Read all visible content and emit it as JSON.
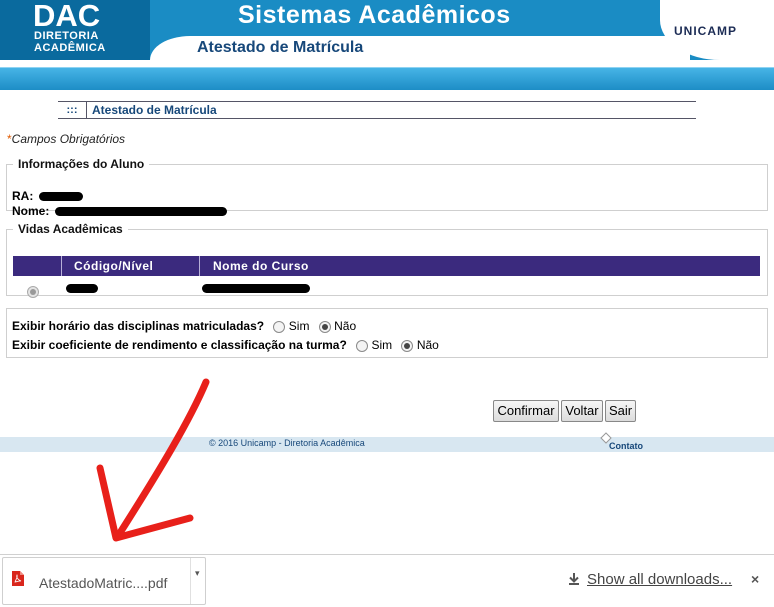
{
  "header": {
    "logo_main": "DAC",
    "logo_line1": "DIRETORIA",
    "logo_line2": "ACADÊMICA",
    "system_title": "Sistemas Acadêmicos",
    "institution": "UNICAMP",
    "page_title": "Atestado de Matrícula"
  },
  "section": {
    "dots": ":::",
    "title": "Atestado de Matrícula"
  },
  "required": {
    "star": "*",
    "text": "Campos Obrigatórios"
  },
  "student_info": {
    "legend": "Informações do Aluno",
    "ra_label": "RA:",
    "name_label": "Nome:"
  },
  "vidas": {
    "legend": "Vidas Acadêmicas",
    "columns": [
      "Código/Nível",
      "Nome do Curso"
    ],
    "rows": [
      {
        "selected": true
      }
    ]
  },
  "options": [
    {
      "question": "Exibir horário das disciplinas matriculadas?",
      "yes": "Sim",
      "no": "Não",
      "value": "Não"
    },
    {
      "question": "Exibir coeficiente de rendimento e classificação na turma?",
      "yes": "Sim",
      "no": "Não",
      "value": "Não"
    }
  ],
  "buttons": {
    "confirm": "Confirmar",
    "back": "Voltar",
    "exit": "Sair"
  },
  "footer": {
    "copyright": "© 2016 Unicamp - Diretoria Acadêmica",
    "contact": "Contato"
  },
  "downloads": {
    "file_name": "AtestadoMatric....pdf",
    "show_all": "Show all downloads...",
    "close": "×"
  },
  "colors": {
    "header_blue": "#1a8cc4",
    "table_header": "#3b2a7e",
    "annotation_arrow": "#e8201a"
  }
}
